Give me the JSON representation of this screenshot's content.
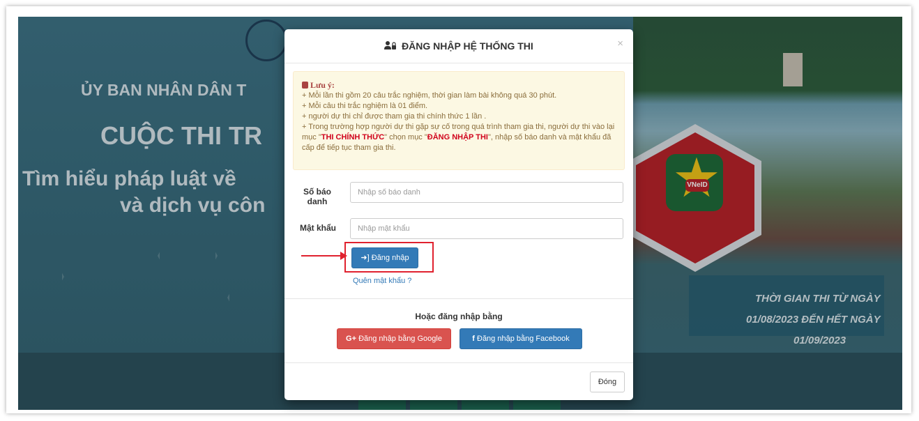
{
  "background": {
    "org_name": "ỦY BAN NHÂN DÂN T",
    "contest_title": "CUỘC THI TR",
    "contest_line1": "Tìm hiểu pháp luật về",
    "contest_line2": "và dịch vụ côn",
    "app_label": "VNeID",
    "dates": [
      "THỜI GIAN THI TỪ NGÀY",
      "01/08/2023 ĐẾN HẾT NGÀY",
      "01/09/2023"
    ]
  },
  "modal": {
    "title": "ĐĂNG NHẬP HỆ THỐNG THI",
    "close_symbol": "×",
    "note": {
      "heading": "Lưu ý:",
      "line1": "+ Mỗi lần thi gồm 20 câu trắc nghiệm, thời gian làm bài không quá 30 phút.",
      "line2": "+ Mỗi câu thi trắc nghiệm là 01 điểm.",
      "line3": "+ người dự thi chỉ được tham gia thi chính thức 1 lần .",
      "line4_a": "+ Trong trường hợp người dự thi gặp sự cố trong quá trình tham gia thi, người dự thi vào lại mục \"",
      "line4_hl1": "THI CHÍNH THỨC",
      "line4_b": "\" chọn mục \"",
      "line4_hl2": "ĐĂNG NHẬP THI",
      "line4_c": "\", nhập số báo danh và mật khẩu đã cấp để tiếp tục tham gia thi."
    },
    "form": {
      "sbd_label_1": "Số báo",
      "sbd_label_2": "danh",
      "sbd_placeholder": "Nhập số báo danh",
      "password_label": "Mật khẩu",
      "password_placeholder": "Nhập mật khẩu",
      "login_button": "Đăng nhập",
      "forgot_link": "Quên mật khẩu ?"
    },
    "social": {
      "or_text": "Hoặc đăng nhập bằng",
      "google_button": "Đăng nhập bằng Google",
      "google_prefix": "G+",
      "facebook_button": "Đăng nhập bằng Facebook",
      "facebook_prefix": "f"
    },
    "footer": {
      "close_button": "Đóng"
    }
  },
  "colors": {
    "primary": "#337ab7",
    "danger": "#d9534f",
    "warning_bg": "#fcf8e3",
    "highlight_red": "#e0212e"
  }
}
